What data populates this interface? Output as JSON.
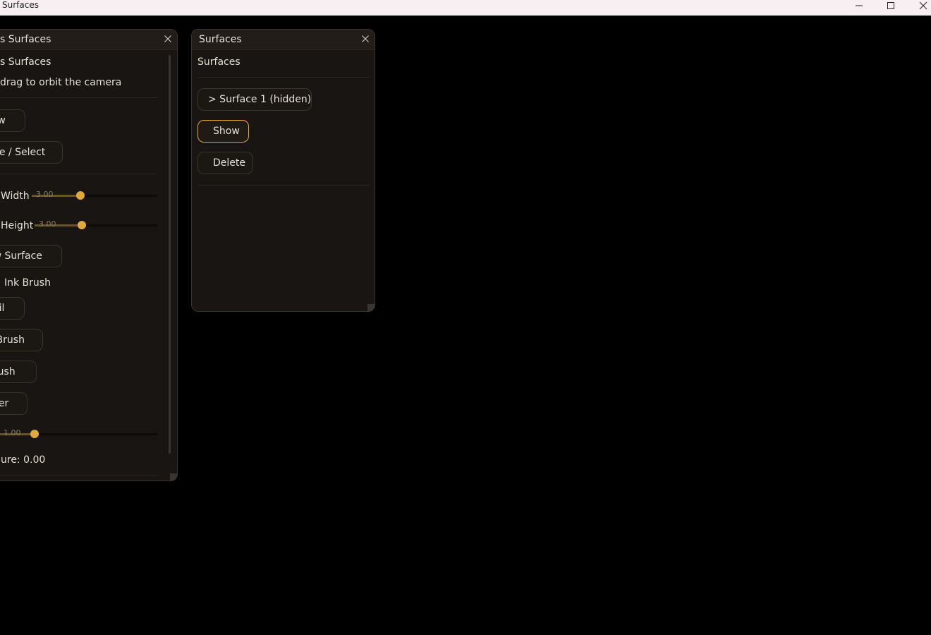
{
  "window": {
    "title": "Surfaces",
    "icons": [
      "minimize-icon",
      "maximize-icon",
      "close-icon"
    ]
  },
  "left_panel": {
    "title": "s Surfaces",
    "heading": "s Surfaces",
    "hint": "drag to orbit the camera",
    "draw_label": "raw",
    "move_select_label": "ove / Select",
    "width_label": "Width",
    "width_value": "3.00",
    "width_fraction": 0.5,
    "height_label": "Height",
    "height_value": "3.00",
    "height_fraction": 0.5,
    "new_surface_label": "ew Surface",
    "brush_section_label": "Ink Brush",
    "pencil_label": "ncil",
    "ink_brush_label": "k Brush",
    "airbrush_label": "brush",
    "eraser_label": "aser",
    "size_value": "1.00",
    "size_fraction": 0.3,
    "pressure_text": "ure: 0.00"
  },
  "right_panel": {
    "title": "Surfaces",
    "heading": "Surfaces",
    "surface_item_label": "> Surface 1 (hidden)",
    "show_label": "Show",
    "delete_label": "Delete"
  },
  "colors": {
    "accent": "#e0a93a",
    "panel_bg": "#181512",
    "background": "#000000",
    "titlebar_bg": "#f8eff3"
  }
}
